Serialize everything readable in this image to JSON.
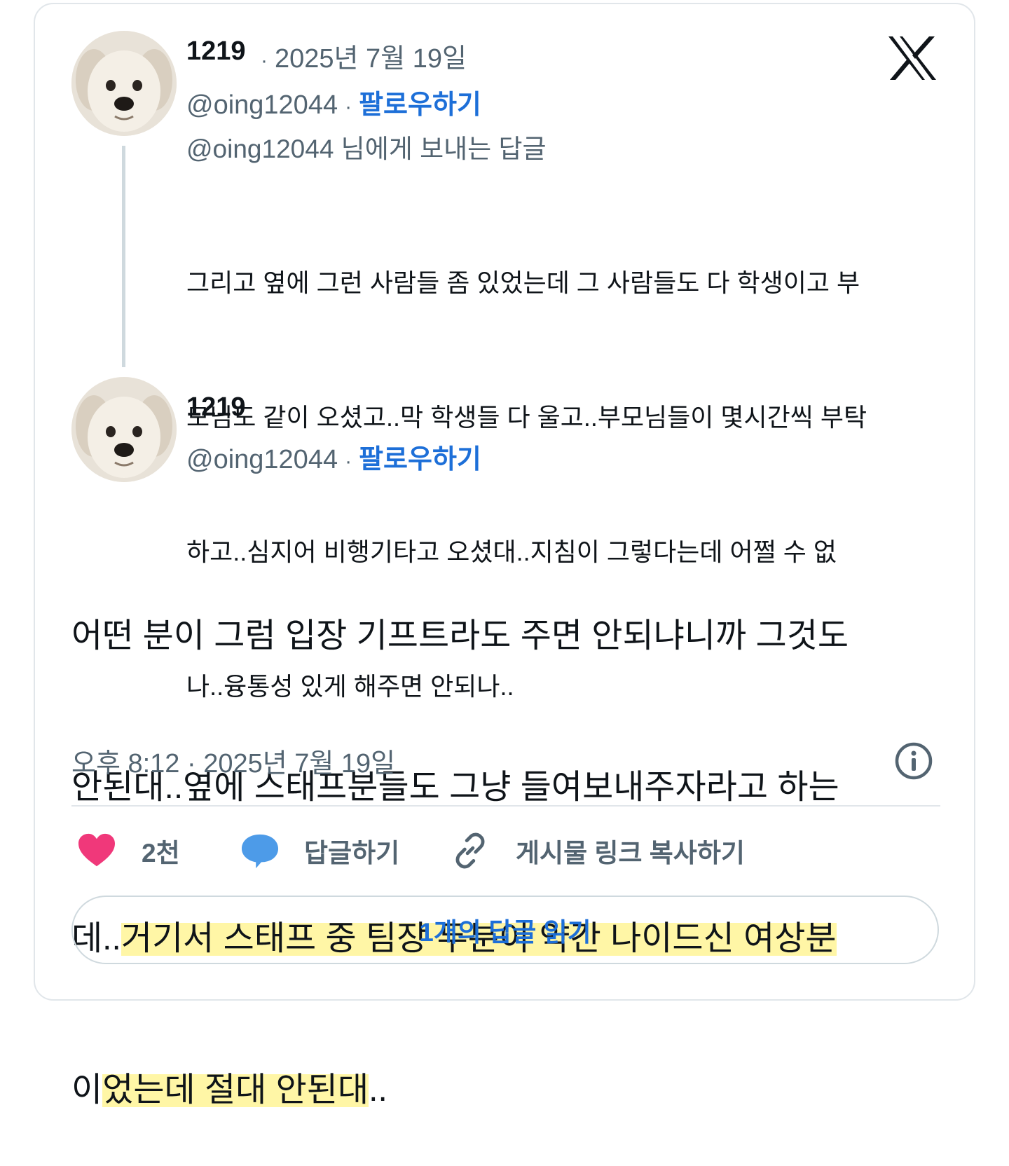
{
  "colors": {
    "link_blue": "#1d6fd8",
    "muted": "#536471",
    "like_pink": "#f0387a",
    "reply_blue": "#4d9be8",
    "highlight": "#fff596"
  },
  "parent_post": {
    "author_name": "1219",
    "date": "2025년 7월 19일",
    "handle": "@oing12044",
    "follow_label": "팔로우하기",
    "reply_to": "@oing12044 님에게 보내는 답글",
    "text_lines": [
      "그리고 옆에 그런 사람들 좀 있었는데 그 사람들도 다 학생이고 부",
      "모님도 같이 오셨고..막 학생들 다 울고..부모님들이 몇시간씩 부탁",
      "하고..심지어 비행기타고 오셨대..지침이 그렇다는데 어쩔 수 없",
      "나..융통성 있게 해주면 안되나.."
    ]
  },
  "main_post": {
    "author_name": "1219",
    "handle": "@oing12044",
    "follow_label": "팔로우하기",
    "text_line1": "어떤 분이 그럼 입장 기프트라도 주면 안되냐니까 그것도",
    "text_line2": "안된대..옆에 스태프분들도 그냥 들여보내주자라고 하는",
    "text_line3_plain": "데..",
    "text_line3_highlight": "거기서 스태프 중 팀장 두분이 약간 나이드신 여상분",
    "text_line4_first": "이",
    "text_line4_highlight": "었는데 절대 안된대",
    "text_line4_tail": "..",
    "timestamp": "오후 8:12 · 2025년 7월 19일"
  },
  "actions": {
    "like_count": "2천",
    "reply_label": "답글하기",
    "copy_link_label": "게시물 링크 복사하기"
  },
  "read_replies_label": "1개의 답글 읽기",
  "icons": [
    "x-logo-icon",
    "info-icon",
    "heart-icon",
    "speech-bubble-icon",
    "link-icon"
  ]
}
